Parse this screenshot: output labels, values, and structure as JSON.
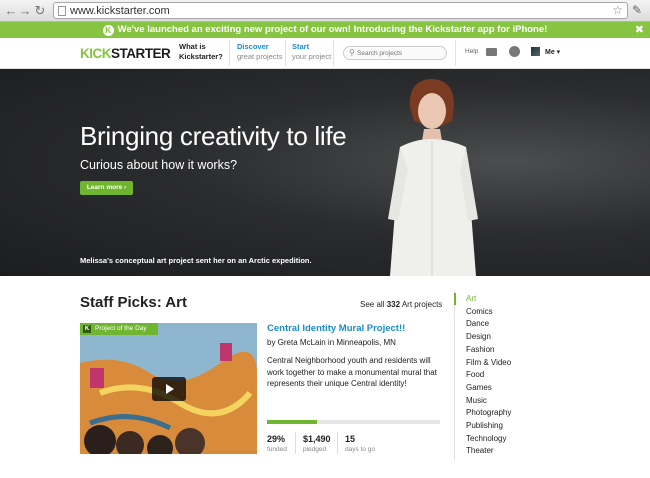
{
  "browser": {
    "url": "www.kickstarter.com"
  },
  "announcement": {
    "text": "We've launched an exciting new project of our own! Introducing the Kickstarter app for iPhone!",
    "close": "✖"
  },
  "header": {
    "logo_part1": "KICK",
    "logo_part2": "STARTER",
    "nav": [
      {
        "top": "What is",
        "bottom": "Kickstarter?"
      },
      {
        "top": "Discover",
        "bottom": "great projects"
      },
      {
        "top": "Start",
        "bottom": "your project"
      }
    ],
    "search_placeholder": "Search projects",
    "help": "Help",
    "user": "Me ▾"
  },
  "hero": {
    "title": "Bringing creativity to life",
    "subtitle": "Curious about how it works?",
    "button": "Learn more ›",
    "caption": "Melissa's conceptual art project sent her on an Arctic expedition."
  },
  "staff_picks": {
    "title": "Staff Picks: Art",
    "see_all_prefix": "See all ",
    "see_all_count": "332",
    "see_all_suffix": " Art projects"
  },
  "project": {
    "badge": "Project of the Day",
    "badge_k": "K",
    "title": "Central Identity Mural Project!!",
    "by": "by Greta McLain in Minneapolis, MN",
    "description": "Central Neighborhood youth and residents will work together to make a monumental mural that represents their unique Central identity!",
    "progress_percent": 29,
    "stats": [
      {
        "value": "29%",
        "label": "funded"
      },
      {
        "value": "$1,490",
        "label": "pledged"
      },
      {
        "value": "15",
        "label": "days to go"
      }
    ]
  },
  "categories": [
    "Art",
    "Comics",
    "Dance",
    "Design",
    "Fashion",
    "Film & Video",
    "Food",
    "Games",
    "Music",
    "Photography",
    "Publishing",
    "Technology",
    "Theater"
  ],
  "colors": {
    "brand_green": "#87c442",
    "link_blue": "#1a8ec6"
  }
}
